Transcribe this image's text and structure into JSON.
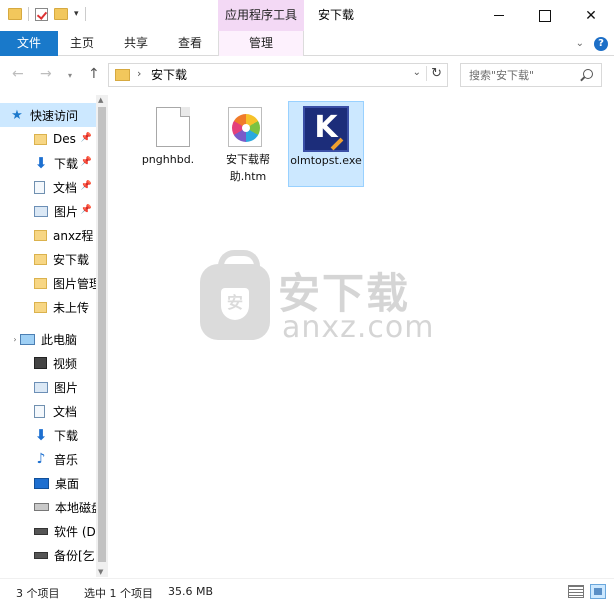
{
  "window": {
    "title": "安下载",
    "contextual_header": "应用程序工具"
  },
  "ribbon": {
    "tabs": [
      "文件",
      "主页",
      "共享",
      "查看",
      "管理"
    ]
  },
  "address": {
    "crumb": "安下载",
    "search_placeholder": "搜索\"安下载\""
  },
  "sidebar": {
    "quick_access_label": "快速访问",
    "quick_items": [
      {
        "label": "Des",
        "icon": "folder-icon",
        "pinned": true
      },
      {
        "label": "下载",
        "icon": "download-icon",
        "pinned": true
      },
      {
        "label": "文档",
        "icon": "document-icon",
        "pinned": true
      },
      {
        "label": "图片",
        "icon": "picture-icon",
        "pinned": true
      },
      {
        "label": "anxz程",
        "icon": "folder-icon",
        "pinned": false
      },
      {
        "label": "安下载",
        "icon": "folder-icon",
        "pinned": false
      },
      {
        "label": "图片管理",
        "icon": "folder-icon",
        "pinned": false
      },
      {
        "label": "未上传",
        "icon": "folder-icon",
        "pinned": false
      }
    ],
    "pc_label": "此电脑",
    "pc_items": [
      {
        "label": "视频",
        "icon": "video-icon"
      },
      {
        "label": "图片",
        "icon": "picture-icon"
      },
      {
        "label": "文档",
        "icon": "document-icon"
      },
      {
        "label": "下载",
        "icon": "download-icon"
      },
      {
        "label": "音乐",
        "icon": "music-icon"
      },
      {
        "label": "桌面",
        "icon": "desktop-icon"
      },
      {
        "label": "本地磁盘",
        "icon": "drive-icon"
      },
      {
        "label": "软件 (D",
        "icon": "drive-icon"
      },
      {
        "label": "备份[乞",
        "icon": "drive-icon"
      }
    ]
  },
  "files": [
    {
      "name": "pnghhbd.",
      "type": "blank",
      "selected": false
    },
    {
      "name": "安下载帮助.htm",
      "type": "htm",
      "selected": false
    },
    {
      "name": "olmtopst.exe",
      "type": "exe",
      "selected": true
    }
  ],
  "exe_icon_letter": "K",
  "watermark": {
    "shield_char": "安",
    "title": "安下载",
    "subtitle": "anxz.com"
  },
  "status": {
    "item_count": "3 个项目",
    "selection": "选中 1 个项目",
    "size": "35.6 MB"
  },
  "colors": {
    "accent": "#1979ca",
    "selection": "#cce8ff",
    "contextual": "#f3d9f5"
  }
}
